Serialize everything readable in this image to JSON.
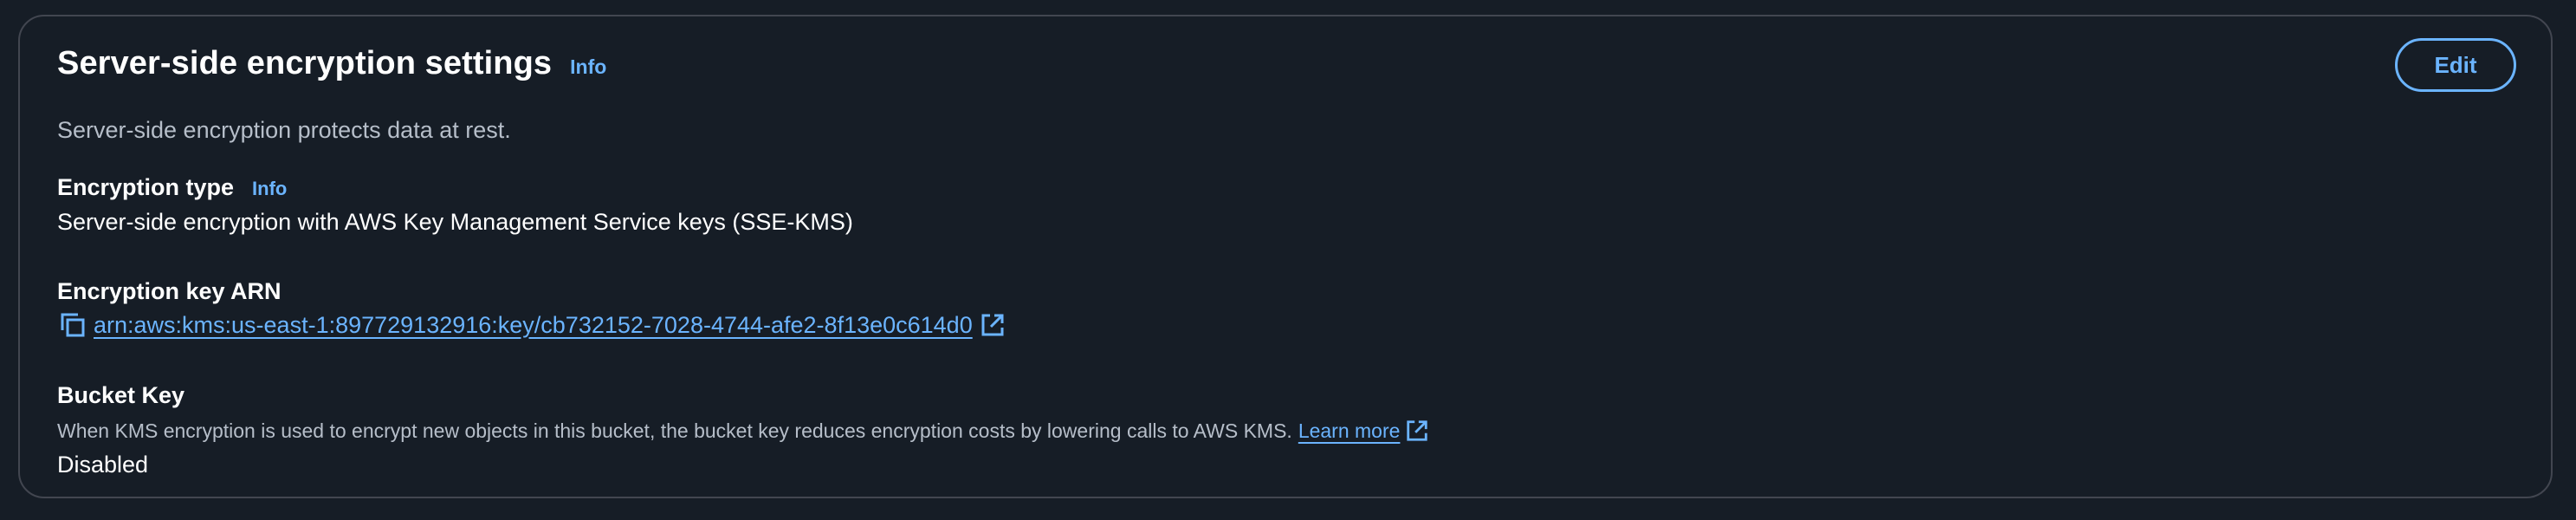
{
  "panel": {
    "title": "Server-side encryption settings",
    "info_label": "Info",
    "description": "Server-side encryption protects data at rest.",
    "edit_label": "Edit"
  },
  "encryption_type": {
    "label": "Encryption type",
    "info_label": "Info",
    "value": "Server-side encryption with AWS Key Management Service keys (SSE-KMS)"
  },
  "encryption_key": {
    "label": "Encryption key ARN",
    "arn": "arn:aws:kms:us-east-1:897729132916:key/cb732152-7028-4744-afe2-8f13e0c614d0"
  },
  "bucket_key": {
    "label": "Bucket Key",
    "description": "When KMS encryption is used to encrypt new objects in this bucket, the bucket key reduces encryption costs by lowering calls to AWS KMS.",
    "learn_more": "Learn more",
    "value": "Disabled"
  },
  "icons": {
    "copy": "copy-icon",
    "external_link": "external-link-icon"
  },
  "colors": {
    "background": "#161d26",
    "border": "#424650",
    "link": "#6bb4ff",
    "heading": "#ffffff",
    "secondary_text": "#b6bec9"
  }
}
